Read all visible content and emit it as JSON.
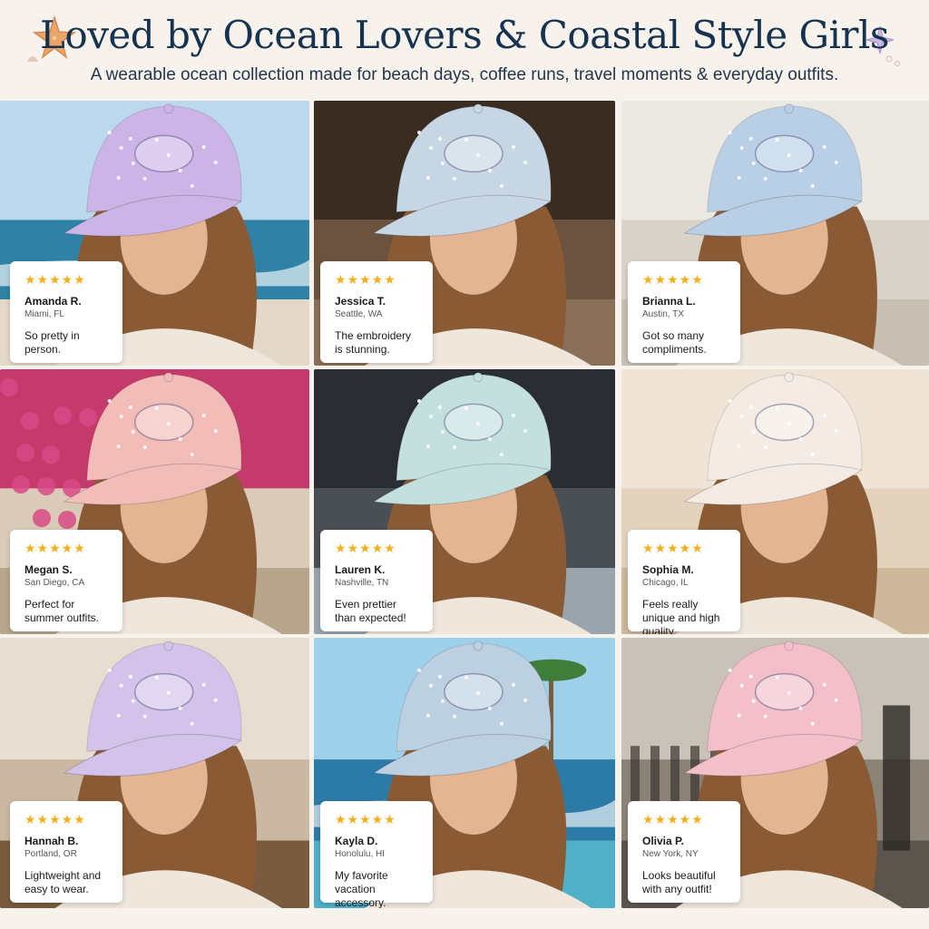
{
  "header": {
    "title": "Loved by Ocean Lovers & Coastal Style Girls",
    "subtitle": "A wearable ocean collection made for beach days, coffee runs, travel moments & everyday outfits."
  },
  "colors": {
    "background": "#f7f2ec",
    "title": "#15324f",
    "star": "#f2b01e"
  },
  "reviews": [
    {
      "stars": "★★★★★",
      "name": "Amanda R.",
      "location": "Miami, FL",
      "text": "So pretty in person.",
      "cap": "octopus",
      "cap_color": "#cdb4e6",
      "scene": "beach"
    },
    {
      "stars": "★★★★★",
      "name": "Jessica T.",
      "location": "Seattle, WA",
      "text": "The embroidery is stunning.",
      "cap": "whale",
      "cap_color": "#c6d6e4",
      "scene": "cafe"
    },
    {
      "stars": "★★★★★",
      "name": "Brianna L.",
      "location": "Austin, TX",
      "text": "Got so many compliments.",
      "cap": "dolphin",
      "cap_color": "#b9cfe6",
      "scene": "room"
    },
    {
      "stars": "★★★★★",
      "name": "Megan S.",
      "location": "San Diego, CA",
      "text": "Perfect for summer outfits.",
      "cap": "seahorse",
      "cap_color": "#f2bcb8",
      "scene": "flowers"
    },
    {
      "stars": "★★★★★",
      "name": "Lauren K.",
      "location": "Nashville, TN",
      "text": "Even prettier than expected!",
      "cap": "turtle",
      "cap_color": "#c3e0df",
      "scene": "car"
    },
    {
      "stars": "★★★★★",
      "name": "Sophia M.",
      "location": "Chicago, IL",
      "text": "Feels really unique and high quality.",
      "cap": "jellyfish",
      "cap_color": "#f4ebe4",
      "scene": "box"
    },
    {
      "stars": "★★★★★",
      "name": "Hannah B.",
      "location": "Portland, OR",
      "text": "Lightweight and easy to wear.",
      "cap": "starfish",
      "cap_color": "#d3c2ea",
      "scene": "desk"
    },
    {
      "stars": "★★★★★",
      "name": "Kayla D.",
      "location": "Honolulu, HI",
      "text": "My favorite vacation accessory.",
      "cap": "manta ray",
      "cap_color": "#bdd0e2",
      "scene": "pool"
    },
    {
      "stars": "★★★★★",
      "name": "Olivia P.",
      "location": "New York, NY",
      "text": "Looks beautiful with any outfit!",
      "cap": "crab",
      "cap_color": "#f2bfca",
      "scene": "street"
    }
  ]
}
